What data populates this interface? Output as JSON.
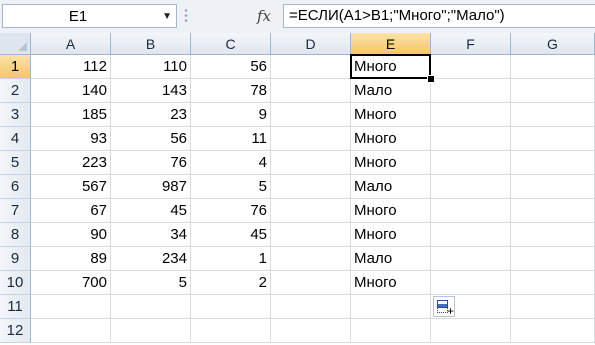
{
  "formula_bar": {
    "name_box": "E1",
    "fx_icon": "fx",
    "formula": "=ЕСЛИ(A1>B1;\"Много\";\"Мало\")"
  },
  "sheet": {
    "columns": [
      "A",
      "B",
      "C",
      "D",
      "E",
      "F",
      "G"
    ],
    "rows": [
      "1",
      "2",
      "3",
      "4",
      "5",
      "6",
      "7",
      "8",
      "9",
      "10",
      "11",
      "12"
    ],
    "selected_column": "E",
    "selected_row": "1",
    "cells": [
      {
        "A": "112",
        "B": "110",
        "C": "56",
        "E": "Много"
      },
      {
        "A": "140",
        "B": "143",
        "C": "78",
        "E": "Мало"
      },
      {
        "A": "185",
        "B": "23",
        "C": "9",
        "E": "Много"
      },
      {
        "A": "93",
        "B": "56",
        "C": "11",
        "E": "Много"
      },
      {
        "A": "223",
        "B": "76",
        "C": "4",
        "E": "Много"
      },
      {
        "A": "567",
        "B": "987",
        "C": "5",
        "E": "Мало"
      },
      {
        "A": "67",
        "B": "45",
        "C": "76",
        "E": "Много"
      },
      {
        "A": "90",
        "B": "34",
        "C": "45",
        "E": "Много"
      },
      {
        "A": "89",
        "B": "234",
        "C": "1",
        "E": "Мало"
      },
      {
        "A": "700",
        "B": "5",
        "C": "2",
        "E": "Много"
      },
      {},
      {}
    ]
  },
  "icons": {
    "name_box_dropdown": "chevron-down-icon",
    "insert_function": "fx-icon",
    "paste_options": "paste-options-icon",
    "select_all": "select-all-icon"
  }
}
